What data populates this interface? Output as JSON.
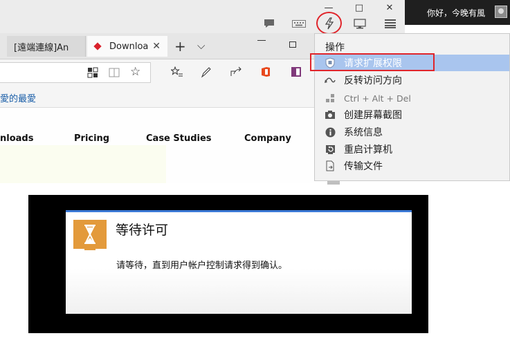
{
  "window_controls": {
    "minimize": "—",
    "maximize": "□",
    "close": "✕"
  },
  "greeting": "你好，今晚有風",
  "browser": {
    "tabs": [
      {
        "label": "[遠端連線]An"
      },
      {
        "label": "Downloa",
        "close": "✕"
      }
    ],
    "new_tab": "+",
    "tab_list": "⌵",
    "favorites_text": "愛的最愛",
    "nav_links": [
      "nloads",
      "Pricing",
      "Case Studies",
      "Company"
    ]
  },
  "menu": {
    "header": "操作",
    "items": [
      {
        "label": "请求扩展权限",
        "icon": "shield-icon",
        "highlighted": true
      },
      {
        "label": "反转访问方向",
        "icon": "swap-icon"
      },
      {
        "label": "Ctrl + Alt + Del",
        "icon": "keys-icon",
        "disabled": true
      },
      {
        "label": "创建屏幕截图",
        "icon": "camera-icon"
      },
      {
        "label": "系统信息",
        "icon": "info-icon"
      },
      {
        "label": "重启计算机",
        "icon": "restart-icon"
      },
      {
        "label": "传输文件",
        "icon": "file-transfer-icon"
      }
    ]
  },
  "dialog": {
    "title": "等待许可",
    "message": "请等待，直到用户帐户控制请求得到确认。"
  },
  "colors": {
    "accent": "#e0252b",
    "highlight": "#a9c5ee",
    "hourglass": "#e39a3b",
    "link": "#1a5ea8"
  }
}
